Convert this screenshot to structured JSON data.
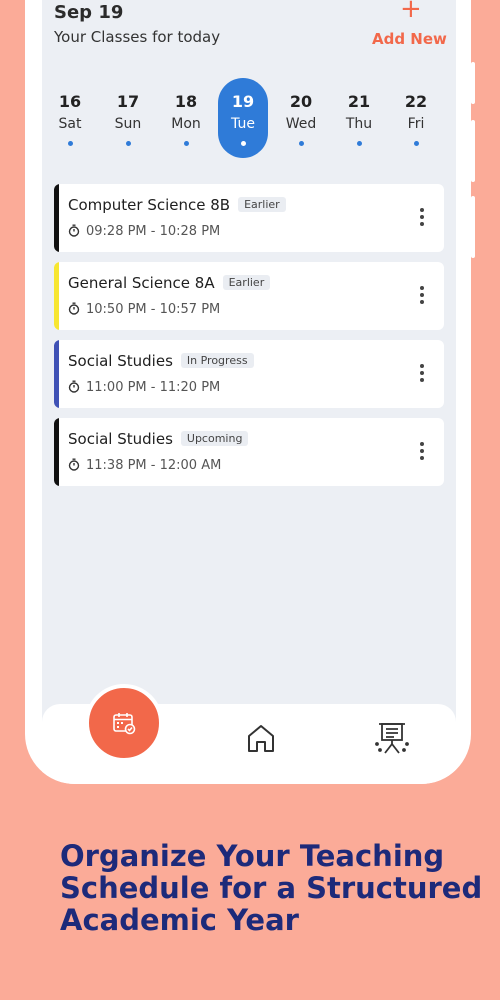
{
  "header": {
    "date": "Sep 19",
    "subtitle": "Your Classes for today",
    "add_icon": "+",
    "add_label": "Add New"
  },
  "days": [
    {
      "num": "16",
      "weekday": "Sat",
      "active": false
    },
    {
      "num": "17",
      "weekday": "Sun",
      "active": false
    },
    {
      "num": "18",
      "weekday": "Mon",
      "active": false
    },
    {
      "num": "19",
      "weekday": "Tue",
      "active": true
    },
    {
      "num": "20",
      "weekday": "Wed",
      "active": false
    },
    {
      "num": "21",
      "weekday": "Thu",
      "active": false
    },
    {
      "num": "22",
      "weekday": "Fri",
      "active": false
    }
  ],
  "classes": [
    {
      "title": "Computer Science 8B",
      "status": "Earlier",
      "time": "09:28 PM - 10:28 PM",
      "color": "#111111"
    },
    {
      "title": "General Science 8A",
      "status": "Earlier",
      "time": "10:50 PM - 10:57 PM",
      "color": "#F7E631"
    },
    {
      "title": "Social Studies",
      "status": "In Progress",
      "time": "11:00 PM - 11:20 PM",
      "color": "#3F51B5"
    },
    {
      "title": "Social Studies",
      "status": "Upcoming",
      "time": "11:38 PM - 12:00 AM",
      "color": "#111111"
    }
  ],
  "nav": {
    "items": [
      "calendar-icon",
      "home-icon",
      "presentation-board-icon"
    ],
    "active": "calendar-icon"
  },
  "colors": {
    "accent": "#F2684A",
    "primary": "#2F7BD8",
    "background": "#FBAB98",
    "caption": "#1D2A7A"
  },
  "caption": "Organize Your Teaching Schedule for a Structured Academic Year"
}
